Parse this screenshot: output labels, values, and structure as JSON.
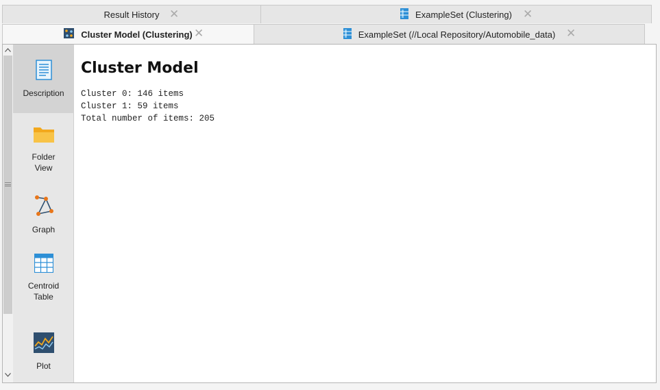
{
  "tabs": {
    "row1": [
      {
        "label": "Result History",
        "icon": "none"
      },
      {
        "label": "ExampleSet (Clustering)",
        "icon": "exampleset-icon"
      }
    ],
    "row2": [
      {
        "label": "Cluster Model (Clustering)",
        "icon": "cluster-model-icon",
        "active": true
      },
      {
        "label": "ExampleSet (//Local Repository/Automobile_data)",
        "icon": "exampleset-icon"
      }
    ],
    "close_glyph": "✕"
  },
  "sidebar": {
    "items": [
      {
        "label": "Description",
        "icon": "description-icon",
        "selected": true
      },
      {
        "label": "Folder\nView",
        "icon": "folder-icon"
      },
      {
        "label": "Graph",
        "icon": "graph-icon"
      },
      {
        "label": "Centroid\nTable",
        "icon": "table-icon"
      },
      {
        "label": "Plot",
        "icon": "plot-icon"
      }
    ]
  },
  "main": {
    "title": "Cluster Model",
    "lines": [
      "Cluster 0: 146 items",
      "Cluster 1: 59 items",
      "Total number of items: 205"
    ]
  },
  "colors": {
    "accent_blue": "#2d8fd6",
    "folder_orange": "#f2a81d",
    "graph_orange": "#e8761a"
  }
}
